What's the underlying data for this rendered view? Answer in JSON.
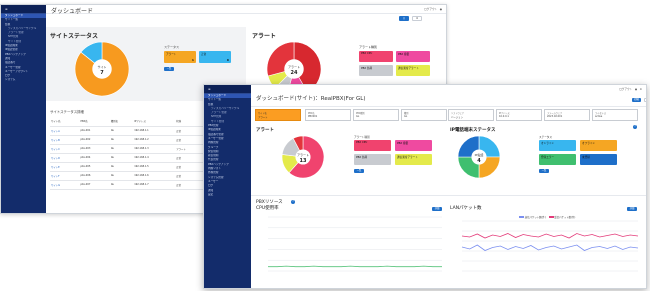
{
  "back_window": {
    "title": "ダッシュボード",
    "sidebar": [
      "ダッシュボード",
      "サイト一覧",
      "監視",
      "ディスカバリーサイクル",
      "アラート管理",
      "NTP管理",
      "サイト管理",
      "IP電話端末",
      "IP電話管理",
      "PBXバックアップ",
      "通知",
      "電話番号",
      "ユーザー管理",
      "ユーザーアカウント",
      "ログ",
      "システム"
    ],
    "site_status": {
      "title": "サイトステータス",
      "donut_label": "サイト",
      "count": "7",
      "status_label": "ステータス",
      "tiles": [
        {
          "label": "アラート",
          "num": "1",
          "color": "#f5a623"
        },
        {
          "label": "正常",
          "num": "6",
          "color": "#38b6ef"
        }
      ],
      "btn": "一覧"
    },
    "alert": {
      "title": "アラート",
      "count": "24",
      "type_label": "アラート種別",
      "tiles": [
        {
          "label": "PBX CPU",
          "num": "",
          "color": "#f0436e"
        },
        {
          "label": "PBX 容量",
          "num": "",
          "color": "#ef4aa0"
        },
        {
          "label": "PBX 負荷",
          "num": "",
          "color": "#c8cbd0"
        },
        {
          "label": "通信異常アラート",
          "num": "",
          "color": "#e4ea4b"
        }
      ],
      "btn": "一覧"
    },
    "table_title": "サイトステータス詳細",
    "table_rows": [
      [
        "サイト名",
        "PBX名",
        "種別名",
        "IPアドレス",
        "状態",
        "更新日時"
      ],
      [
        "サイトA",
        "pbx-001",
        "GL",
        "192.168.1.1",
        "正常",
        "2023/02/01"
      ],
      [
        "サイトB",
        "pbx-002",
        "GL",
        "192.168.1.2",
        "正常",
        "2023/02/01"
      ],
      [
        "サイトC",
        "pbx-003",
        "GL",
        "192.168.1.3",
        "アラート",
        "2023/02/01"
      ],
      [
        "サイトD",
        "pbx-004",
        "GL",
        "192.168.1.4",
        "正常",
        "2023/02/01"
      ],
      [
        "サイトE",
        "pbx-005",
        "GL",
        "192.168.1.5",
        "正常",
        "2023/02/01"
      ],
      [
        "サイトF",
        "pbx-006",
        "GL",
        "192.168.1.6",
        "正常",
        "2023/02/01"
      ],
      [
        "サイトG",
        "pbx-007",
        "GL",
        "192.168.1.7",
        "正常",
        "2023/02/01"
      ]
    ]
  },
  "front_window": {
    "title": "ダッシュボード(サイト)：RealPBX(For GL)",
    "sidebar": [
      "ダッシュボード",
      "サイト一覧",
      "監視",
      "ディスカバリーサイクル",
      "アラート管理",
      "NTP管理",
      "サイト管理",
      "PBX管理",
      "IP電話端末",
      "電話番号管理",
      "ユーザー管理",
      "内線管理",
      "グループ",
      "発信規制",
      "着信規制",
      "代表管理",
      "PBXバックアップ",
      "内線リスト",
      "外線管理",
      "システム管理",
      "ユーザー",
      "ログ",
      "通知",
      "設定"
    ],
    "info_boxes": [
      {
        "k": "サイト名",
        "v": "アラート",
        "hl": true
      },
      {
        "k": "PBX名",
        "v": "PBX001",
        "hl": false
      },
      {
        "k": "PBX種別",
        "v": "GL",
        "hl": false
      },
      {
        "k": "種別",
        "v": "GL",
        "hl": false
      },
      {
        "k": "ソフトウェア",
        "v": "バージョン",
        "hl": false
      },
      {
        "k": "IPアドレス",
        "v": "10.0.0.1",
        "hl": false
      },
      {
        "k": "ファームウェア",
        "v": "2023.02.001",
        "hl": false
      },
      {
        "k": "ライセンス",
        "v": "active",
        "hl": false
      }
    ],
    "alert": {
      "title": "アラート",
      "count": "13",
      "type_label": "アラート種別",
      "tiles": [
        {
          "label": "PBX CPU",
          "num": "",
          "color": "#f0436e"
        },
        {
          "label": "PBX 容量",
          "num": "",
          "color": "#ef4aa0"
        },
        {
          "label": "PBX 負荷",
          "num": "",
          "color": "#c8cbd0"
        },
        {
          "label": "通信異常アラート",
          "num": "",
          "color": "#e4ea4b"
        }
      ],
      "btn": "一覧"
    },
    "ipphone": {
      "title": "IP電話端末ステータス",
      "count": "4",
      "status_label": "ステータス",
      "tiles": [
        {
          "label": "オンライン",
          "num": "",
          "color": "#38b6ef"
        },
        {
          "label": "オフライン",
          "num": "",
          "color": "#f5a623"
        },
        {
          "label": "登録エラー",
          "num": "",
          "color": "#3fbf6f"
        },
        {
          "label": "未登録",
          "num": "",
          "color": "#1e6fc9"
        }
      ],
      "btn": "一覧"
    },
    "pbx_resource": "PBXリソース",
    "cpu_title": "CPU使用率",
    "lan_title": "LANパケット数",
    "lan_legend": [
      "送信パケット数(件)",
      "受信パケット数(件)"
    ],
    "detail_btn": "詳細",
    "print_btn": "印刷"
  },
  "colors": {
    "sidebar": "#132c6b",
    "accent": "#1e6fc9",
    "orange": "#fb9d22",
    "red": "#e3343c",
    "pink": "#ef4aa0",
    "blue": "#38b6ef",
    "green": "#3fbf6f"
  }
}
